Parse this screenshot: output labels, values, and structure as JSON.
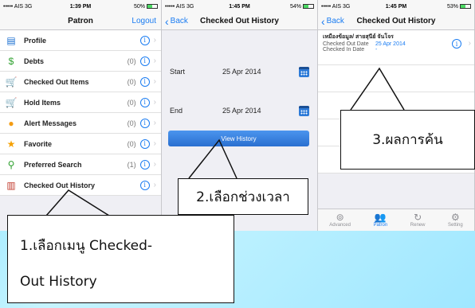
{
  "status": {
    "s1": {
      "carrier": "••••• AIS 3G",
      "time": "1:39 PM",
      "battery": "50%",
      "level": 0.5
    },
    "s2": {
      "carrier": "••••• AIS 3G",
      "time": "1:45 PM",
      "battery": "54%",
      "level": 0.54
    },
    "s3": {
      "carrier": "••••• AIS 3G",
      "time": "1:45 PM",
      "battery": "53%",
      "level": 0.53
    }
  },
  "screen1": {
    "title": "Patron",
    "logout": "Logout",
    "menu": [
      {
        "label": "Profile",
        "count": "",
        "icon": "id-card-icon",
        "glyph": "▤",
        "color": "#1a6fd0"
      },
      {
        "label": "Debts",
        "count": "(0)",
        "icon": "dollar-icon",
        "glyph": "$",
        "color": "#2ea02e"
      },
      {
        "label": "Checked Out Items",
        "count": "(0)",
        "icon": "cart-out-icon",
        "glyph": "🛒",
        "color": "#c9a400"
      },
      {
        "label": "Hold Items",
        "count": "(0)",
        "icon": "cart-hold-icon",
        "glyph": "🛒",
        "color": "#c9a400"
      },
      {
        "label": "Alert Messages",
        "count": "(0)",
        "icon": "speech-bubble-icon",
        "glyph": "●",
        "color": "#f39c12"
      },
      {
        "label": "Favorite",
        "count": "(0)",
        "icon": "star-icon",
        "glyph": "★",
        "color": "#f5a000"
      },
      {
        "label": "Preferred Search",
        "count": "(1)",
        "icon": "magnifier-icon",
        "glyph": "⚲",
        "color": "#2ea02e"
      },
      {
        "label": "Checked Out History",
        "count": "",
        "icon": "books-icon",
        "glyph": "▥",
        "color": "#c0392b"
      }
    ]
  },
  "screen2": {
    "back": "Back",
    "title": "Checked Out History",
    "start_label": "Start",
    "start_value": "25 Apr 2014",
    "end_label": "End",
    "end_value": "25 Apr 2014",
    "button": "View History"
  },
  "screen3": {
    "back": "Back",
    "title": "Checked Out History",
    "item_title": "เหมืองข้อมูล/ สายสุนีย์ จันโจร",
    "out_label": "Checked Out Date",
    "out_value": "25 Apr 2014",
    "in_label": "Checked In Date",
    "in_value": "-",
    "tabs": [
      "Advanced",
      "Patron",
      "Renew",
      "Setting"
    ],
    "active_tab": "Patron"
  },
  "callouts": {
    "c1_line1": "1.เลือกเมนู Checked-",
    "c1_line2": "Out History",
    "c2": "2.เลือกช่วงเวลา",
    "c3": "3.ผลการค้น"
  }
}
